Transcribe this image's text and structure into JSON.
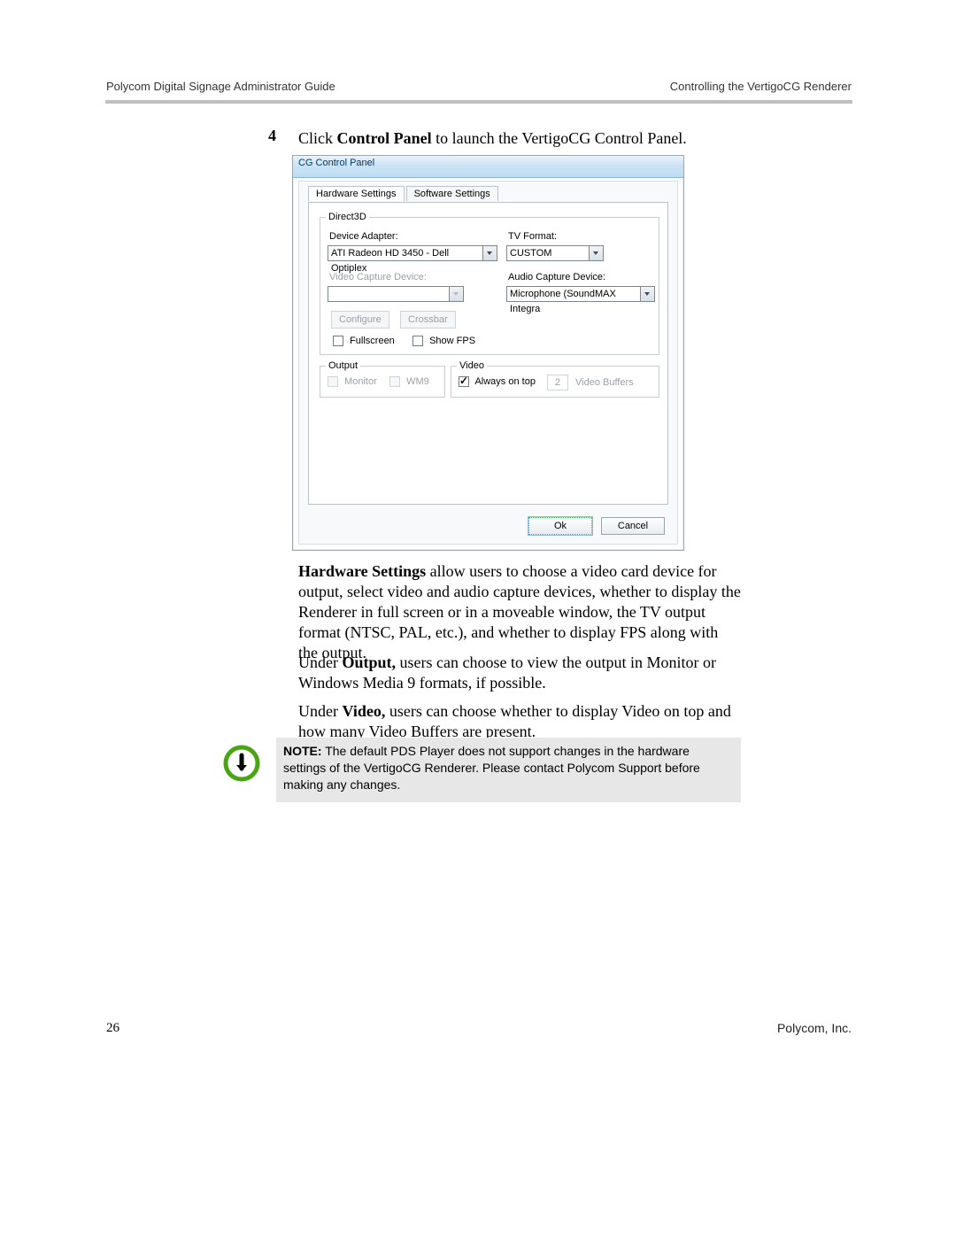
{
  "header": {
    "left": "Polycom Digital Signage Administrator Guide",
    "right": "Controlling the VertigoCG Renderer"
  },
  "footer": {
    "page": "26",
    "company": "Polycom, Inc."
  },
  "step": {
    "number": "4",
    "pre": "Click ",
    "bold": "Control Panel",
    "post": " to launch the VertigoCG Control Panel."
  },
  "dialog": {
    "title": "CG Control Panel",
    "tabs": {
      "hw": "Hardware Settings",
      "sw": "Software Settings"
    },
    "direct3d": {
      "legend": "Direct3D",
      "device_adapter_label": "Device Adapter:",
      "device_adapter_value": "ATI Radeon HD 3450 - Dell Optiplex",
      "tv_format_label": "TV Format:",
      "tv_format_value": "CUSTOM",
      "video_capture_label": "Video Capture Device:",
      "video_capture_value": "",
      "audio_capture_label": "Audio Capture Device:",
      "audio_capture_value": "Microphone (SoundMAX Integra",
      "configure_btn": "Configure",
      "crossbar_btn": "Crossbar",
      "fullscreen_label": "Fullscreen",
      "show_fps_label": "Show FPS"
    },
    "output": {
      "legend": "Output",
      "monitor": "Monitor",
      "wm9": "WM9"
    },
    "video": {
      "legend": "Video",
      "always_on_top": "Always on top",
      "buffers_value": "2",
      "buffers_label": "Video Buffers"
    },
    "ok": "Ok",
    "cancel": "Cancel"
  },
  "para1": {
    "bold": "Hardware Settings",
    "rest": " allow users to choose a video card device for output, select video and audio capture devices, whether to display the Renderer in full screen or in a moveable window, the TV output format (NTSC, PAL, etc.), and whether to display FPS along with the output."
  },
  "para2": {
    "pre": "Under ",
    "bold": "Output,",
    "rest": " users can choose to view the output in Monitor or Windows Media 9 formats, if possible."
  },
  "para3": {
    "pre": "Under ",
    "bold": "Video,",
    "rest": " users can choose whether to display Video on top and how many Video Buffers are present."
  },
  "note": {
    "label": "NOTE:",
    "body": " The default PDS Player does not support changes in the hardware settings of the VertigoCG Renderer. Please contact Polycom Support before making any changes."
  }
}
